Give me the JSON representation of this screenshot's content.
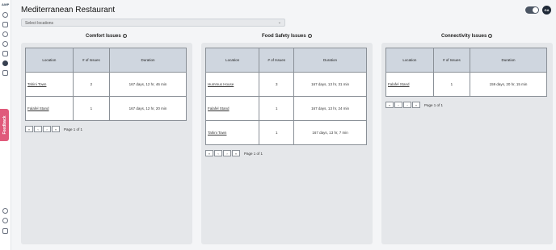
{
  "sidebar": {
    "logo": "AMP",
    "feedback_label": "Feedback",
    "nav_icons": [
      "home-icon",
      "building-icon",
      "sensor-icon",
      "user-icon",
      "document-icon",
      "palette-icon",
      "tag-icon"
    ],
    "bottom_icons": [
      "help-icon",
      "settings-icon",
      "logout-icon"
    ]
  },
  "header": {
    "title": "Mediterranean Restaurant",
    "avatar_initials": "GA",
    "location_select": {
      "placeholder": "Select locations"
    }
  },
  "panels": [
    {
      "title": "Comfort Issues",
      "headers": [
        "Location",
        "# of Issues",
        "Duration"
      ],
      "rows": [
        [
          "Tahini Town",
          "2",
          "167 days, 12 hr, 46 min"
        ],
        [
          "Falafel Stand",
          "1",
          "167 days, 12 hr, 20 min"
        ]
      ],
      "page_text": "Page 1 of 1"
    },
    {
      "title": "Food Safety Issues",
      "headers": [
        "Location",
        "# of Issues",
        "Duration"
      ],
      "rows": [
        [
          "Hummus House",
          "3",
          "167 days, 13 hr, 31 min"
        ],
        [
          "Falafel Stand",
          "1",
          "167 days, 13 hr, 24 min"
        ],
        [
          "Tahini Town",
          "1",
          "167 days, 13 hr, 7 min"
        ]
      ],
      "page_text": "Page 1 of 1"
    },
    {
      "title": "Connectivity Issues",
      "headers": [
        "Location",
        "# of Issues",
        "Duration"
      ],
      "rows": [
        [
          "Falafel Stand",
          "1",
          "159 days, 20 hr, 15 min"
        ]
      ],
      "page_text": "Page 1 of 1"
    }
  ],
  "pager_glyphs": {
    "first": "«",
    "prev": "‹",
    "next": "›",
    "last": "»"
  }
}
